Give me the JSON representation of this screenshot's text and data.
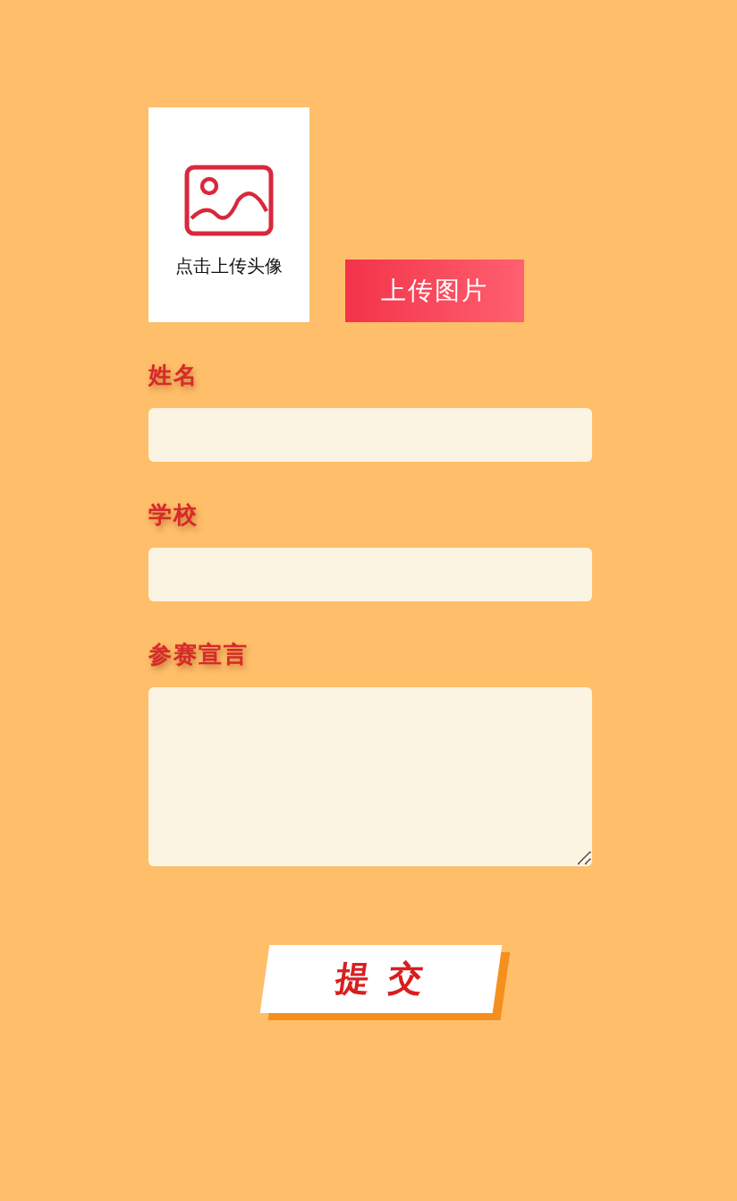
{
  "avatar": {
    "caption": "点击上传头像"
  },
  "upload_button": "上传图片",
  "fields": [
    {
      "label": "姓名",
      "kind": "input"
    },
    {
      "label": "学校",
      "kind": "input"
    },
    {
      "label": "参赛宣言",
      "kind": "textarea"
    }
  ],
  "submit_button": "提 交"
}
